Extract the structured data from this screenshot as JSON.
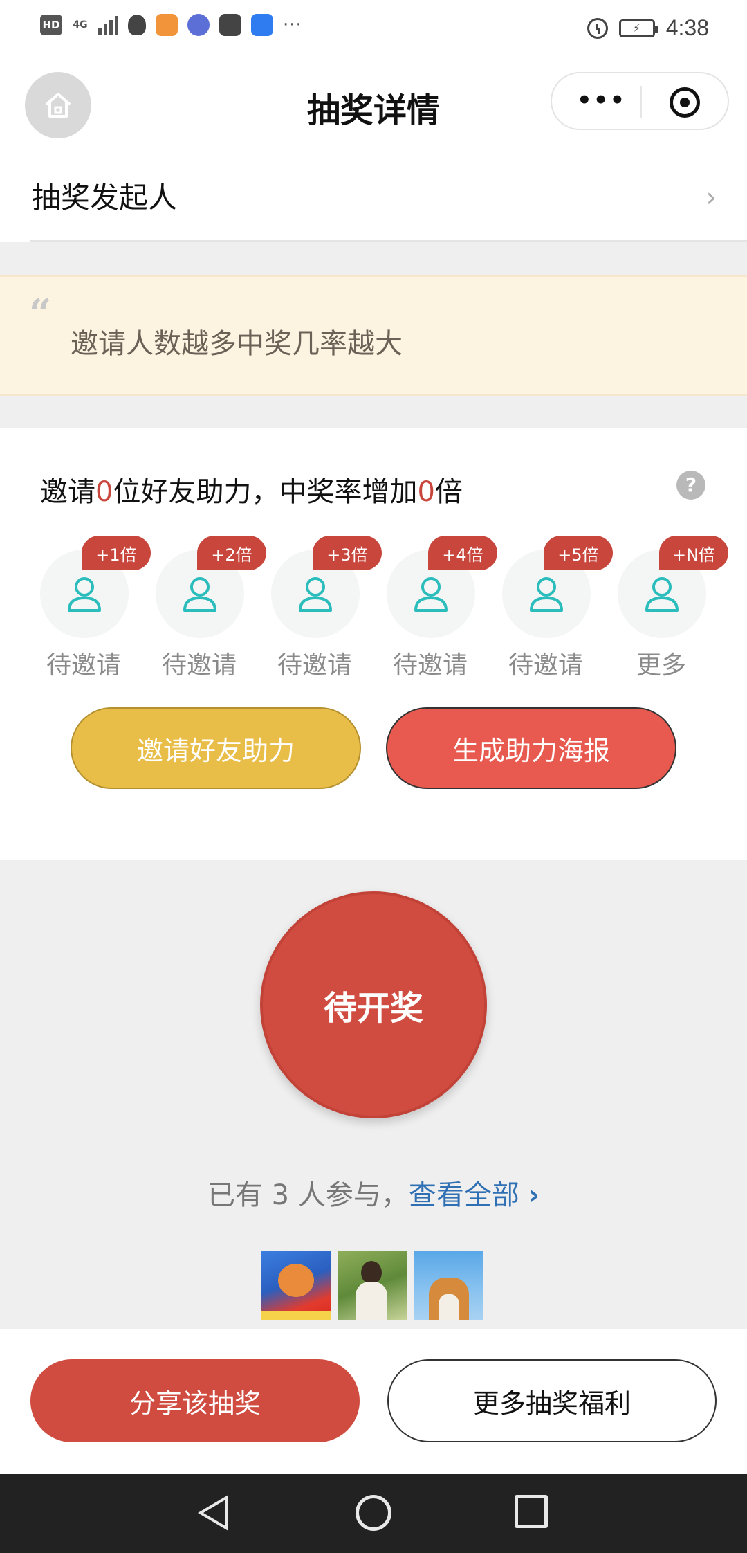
{
  "status_bar": {
    "hd": "HD",
    "network": "4G",
    "dots": "···",
    "time": "4:38"
  },
  "nav": {
    "title": "抽奖详情",
    "more_glyph": "•••"
  },
  "initiator": {
    "label": "抽奖发起人",
    "chevron": "›"
  },
  "quote": {
    "mark": "“",
    "text": "邀请人数越多中奖几率越大"
  },
  "invite": {
    "title_prefix": "邀请",
    "friends_count": "0",
    "title_middle": "位好友助力，中奖率增加",
    "multiplier": "0",
    "title_suffix": "倍",
    "help_glyph": "?",
    "slots": [
      {
        "badge": "+1倍",
        "caption": "待邀请"
      },
      {
        "badge": "+2倍",
        "caption": "待邀请"
      },
      {
        "badge": "+3倍",
        "caption": "待邀请"
      },
      {
        "badge": "+4倍",
        "caption": "待邀请"
      },
      {
        "badge": "+5倍",
        "caption": "待邀请"
      },
      {
        "badge": "+N倍",
        "caption": "更多"
      }
    ],
    "invite_button": "邀请好友助力",
    "poster_button": "生成助力海报"
  },
  "draw": {
    "status": "待开奖"
  },
  "participants": {
    "prefix": "已有 ",
    "count": "3",
    "suffix": " 人参与，",
    "view_all": "查看全部",
    "arrow": "›"
  },
  "bottom_bar": {
    "share": "分享该抽奖",
    "more": "更多抽奖福利"
  },
  "colors": {
    "accent_red": "#d04c40",
    "accent_yellow": "#e8bd48",
    "link_blue": "#2f6fb3"
  }
}
